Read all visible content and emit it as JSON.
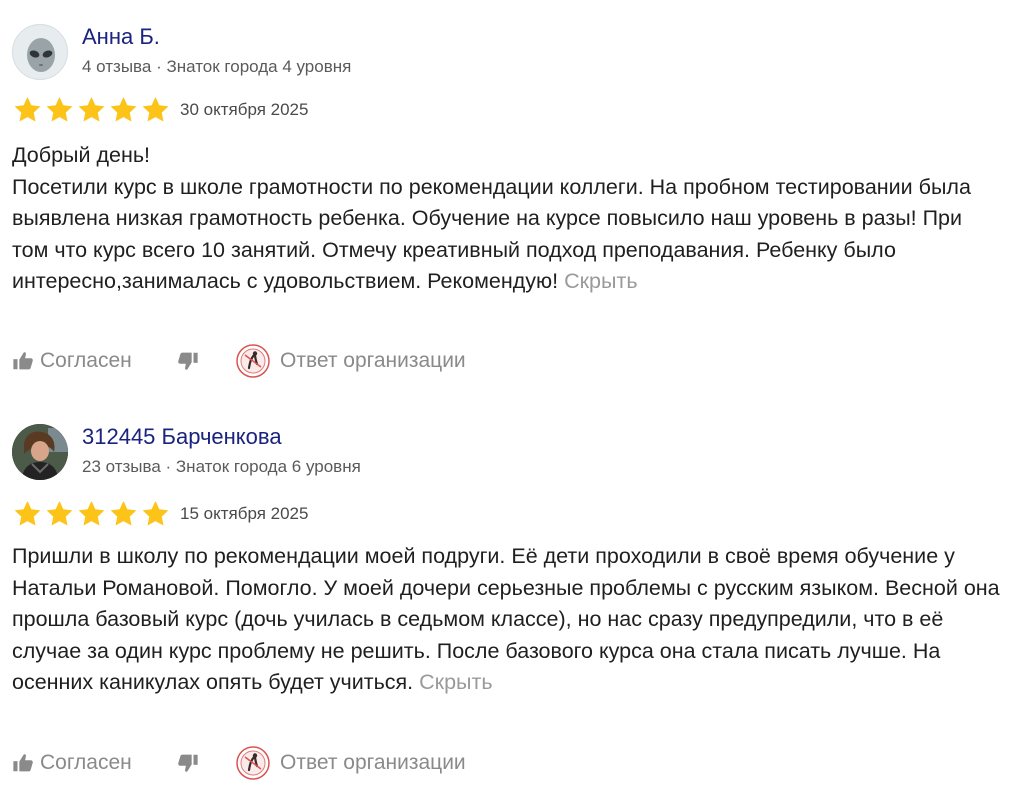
{
  "reviews": [
    {
      "author": "Анна Б.",
      "meta": "4 отзыва · Знаток города 4 уровня",
      "avatar_icon": "alien-icon",
      "rating": 5,
      "date": "30 октября 2025",
      "paragraphs": [
        "Добрый день!",
        "Посетили курс в школе грамотности по рекомендации коллеги. На пробном тестировании была выявлена низкая грамотность ребенка. Обучение на курсе повысило наш уровень в разы! При том что курс всего 10 занятий. Отмечу креативный подход преподавания. Ребенку было интересно,занималась с удовольствием. Рекомендую!"
      ],
      "hide_label": "Скрыть",
      "agree_label": "Согласен",
      "org_reply_label": "Ответ организации"
    },
    {
      "author": "312445 Барченкова",
      "meta": "23 отзыва · Знаток города 6 уровня",
      "avatar_icon": "user-photo",
      "rating": 5,
      "date": "15 октября 2025",
      "paragraphs": [
        "Пришли в школу по рекомендации моей подруги. Её дети проходили в своё время обучение у Натальи Романовой. Помогло. У моей дочери серьезные проблемы с русским языком. Весной она прошла базовый курс (дочь училась в седьмом классе), но нас сразу предупредили, что в её случае за один курс проблему не решить. После базового курса она стала писать лучше. На осенних каникулах опять будет учиться."
      ],
      "hide_label": "Скрыть",
      "agree_label": "Согласен",
      "org_reply_label": "Ответ организации"
    }
  ],
  "colors": {
    "star": "#fcc419",
    "author": "#1a237e",
    "muted": "#8a8a8a"
  }
}
